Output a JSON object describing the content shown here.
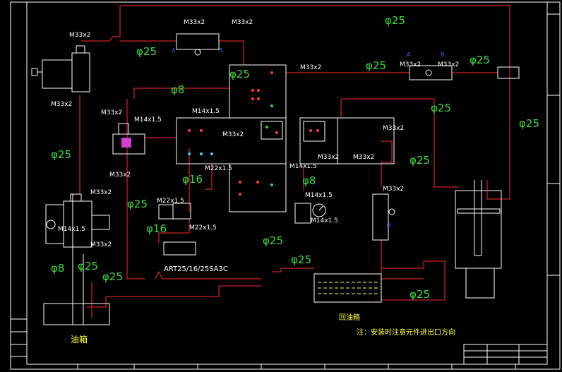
{
  "diagram": {
    "thread_labels": {
      "t1": "M33x2",
      "t2": "M33x2",
      "t3": "M33x2",
      "t4": "M33x2",
      "t5": "M33x2",
      "t6": "M33x2",
      "t7": "M14x1.5",
      "t8": "M14x1.5",
      "t9": "M33x2",
      "t10": "M33x2",
      "t11": "M33x2",
      "t12": "M33x2",
      "t13": "M33x2",
      "t14": "M33x2",
      "t15": "M22x1.5",
      "t16": "M14x1.5",
      "t17": "M14x1.5",
      "t18": "M14x1.5",
      "t19": "M33x2",
      "t20": "M33x2",
      "t21": "M22x1.5",
      "t22": "M22x1.5",
      "t23": "M14x1.5",
      "t24": "M33x2",
      "t25": "M33x2"
    },
    "diameters": {
      "d1": "φ25",
      "d2": "φ25",
      "d3": "φ25",
      "d4": "φ25",
      "d5": "φ25",
      "d6": "φ8",
      "d7": "φ25",
      "d8": "φ25",
      "d9": "φ25",
      "d10": "φ16",
      "d11": "φ25",
      "d12": "φ16",
      "d13": "φ8",
      "d14": "φ25",
      "d15": "φ8",
      "d16": "φ25",
      "d17": "φ25",
      "d18": "φ25",
      "d19": "φ25",
      "d20": "φ25"
    },
    "ports": {
      "a1": "A",
      "b1": "B",
      "a2": "A",
      "b2": "B",
      "b3": "B"
    },
    "coupling_label": "ART25/16/25SA3C",
    "tank_label": "油箱",
    "return_tank_label": "回油箱",
    "note": "注：安装时注意元件进出口方向"
  },
  "colors": {
    "pipe": "#ff2a2a",
    "diameter": "#3ddc3d",
    "note": "#ffff3c",
    "port": "#3a5bff",
    "background": "#000000"
  }
}
